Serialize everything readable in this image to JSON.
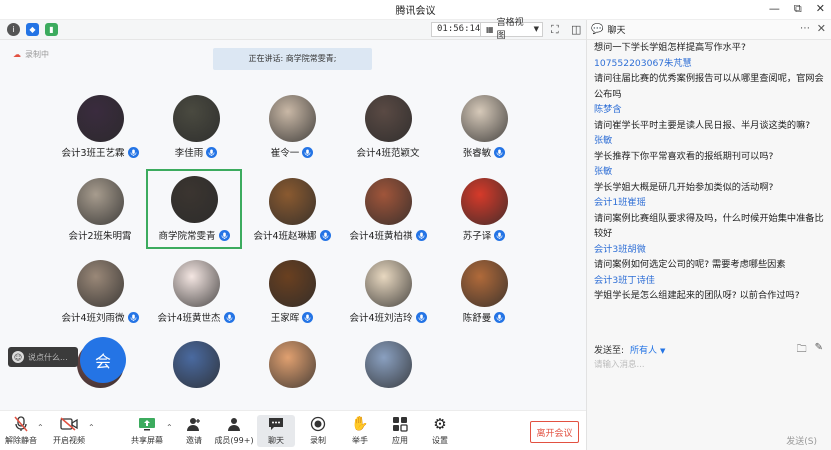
{
  "window": {
    "title": "腾讯会议"
  },
  "video_bar": {
    "timer": "01:56:14",
    "grid_view_label": "宫格视图"
  },
  "stage": {
    "recording_label": "录制中",
    "speaking_label": "正在讲话: 商学院常雯青;",
    "participants": [
      {
        "name": "会计3班王艺霖",
        "mic": true,
        "avatar_color": "#3a2b3e"
      },
      {
        "name": "李佳雨",
        "mic": true,
        "avatar_color": "#4a4a40"
      },
      {
        "name": "崔令一",
        "mic": true,
        "avatar_color": "#c9b8a6"
      },
      {
        "name": "会计4班范颖文",
        "mic": false,
        "avatar_color": "#5a4a44"
      },
      {
        "name": "张睿敏",
        "mic": true,
        "avatar_color": "#d6c9b9"
      },
      {
        "name": "会计2班朱明霄",
        "mic": false,
        "avatar_color": "#a79c8e"
      },
      {
        "name": "商学院常雯青",
        "mic": true,
        "avatar_color": "#3b3530",
        "active": true
      },
      {
        "name": "会计4班赵琳娜",
        "mic": true,
        "avatar_color": "#8a5a30"
      },
      {
        "name": "会计4班黄柏祺",
        "mic": true,
        "avatar_color": "#a0553a"
      },
      {
        "name": "苏子译",
        "mic": true,
        "avatar_color": "#d63a2a"
      },
      {
        "name": "会计4班刘雨微",
        "mic": true,
        "avatar_color": "#9a8878"
      },
      {
        "name": "会计4班黄世杰",
        "mic": true,
        "avatar_color": "#f4e6e2"
      },
      {
        "name": "王家晖",
        "mic": true,
        "avatar_color": "#6a4020"
      },
      {
        "name": "会计4班刘洁玲",
        "mic": true,
        "avatar_color": "#e8d8c0"
      },
      {
        "name": "陈舒曼",
        "mic": true,
        "avatar_color": "#b06a3a"
      },
      {
        "name": "",
        "mic": false,
        "avatar_color": "#7a4a4a"
      },
      {
        "name": "",
        "mic": false,
        "avatar_color": "#4a6aa0"
      },
      {
        "name": "",
        "mic": false,
        "avatar_color": "#e0a070"
      },
      {
        "name": "",
        "mic": false,
        "avatar_color": "#8aa0c0"
      }
    ],
    "chat_pill_placeholder": "说点什么...",
    "blue_circle_char": "会"
  },
  "toolbar": {
    "unmute": "解除静音",
    "video": "开启视频",
    "share": "共享屏幕",
    "invite": "邀请",
    "members": "成员(99+)",
    "chat": "聊天",
    "record": "录制",
    "raise_hand": "举手",
    "apps": "应用",
    "settings": "设置",
    "leave": "离开会议"
  },
  "chat": {
    "title": "聊天",
    "messages": [
      {
        "who": "",
        "text": "想问一下学长学姐怎样提高写作水平?"
      },
      {
        "who": "107552203067朱芃慧",
        "text": "请问往届比赛的优秀案例报告可以从哪里查阅呢，官网会公布吗"
      },
      {
        "who": "陈梦含",
        "text": "请问崔学长平时主要是读人民日报、半月谈这类的嘛?"
      },
      {
        "who": "张敏",
        "text": "学长推荐下你平常喜欢看的报纸期刊可以吗?"
      },
      {
        "who": "张敏",
        "text": "学长学姐大概是研几开始参加类似的活动啊?"
      },
      {
        "who": "会计1班崔瑶",
        "text": "请问案例比赛组队要求得及吗，什么时候开始集中准备比较好"
      },
      {
        "who": "会计3班胡微",
        "text": "请问案例如何选定公司的呢? 需要考虑哪些因素"
      },
      {
        "who": "会计3班丁诗佳",
        "text": "学姐学长是怎么组建起来的团队呀? 以前合作过吗?"
      }
    ],
    "send_to_label": "发送至:",
    "send_to_target": "所有人",
    "input_placeholder": "请输入消息...",
    "send_button": "发送(S)"
  }
}
